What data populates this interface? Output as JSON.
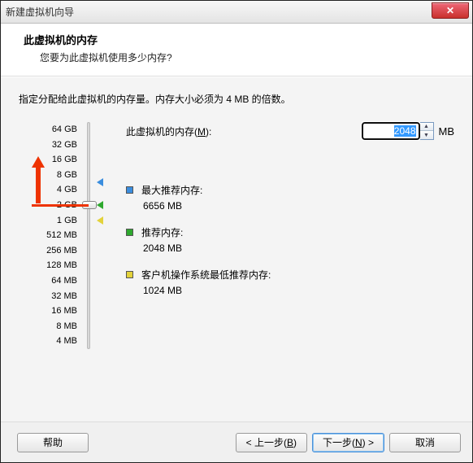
{
  "window": {
    "title": "新建虚拟机向导"
  },
  "header": {
    "title": "此虚拟机的内存",
    "subtitle": "您要为此虚拟机使用多少内存?"
  },
  "content": {
    "description": "指定分配给此虚拟机的内存量。内存大小必须为 4 MB 的倍数。",
    "memory_label_prefix": "此虚拟机的内存(",
    "memory_label_key": "M",
    "memory_label_suffix": "):",
    "memory_value": "2048",
    "memory_unit": "MB",
    "ticks": [
      "64 GB",
      "32 GB",
      "16 GB",
      "8 GB",
      "4 GB",
      "2 GB",
      "1 GB",
      "512 MB",
      "256 MB",
      "128 MB",
      "64 MB",
      "32 MB",
      "16 MB",
      "8 MB",
      "4 MB"
    ],
    "markers": {
      "max": {
        "label": "最大推荐内存:",
        "value": "6656 MB",
        "color": "#3a8dde",
        "tick_index": 3.5
      },
      "rec": {
        "label": "推荐内存:",
        "value": "2048 MB",
        "color": "#2ea82e",
        "tick_index": 5
      },
      "min": {
        "label": "客户机操作系统最低推荐内存:",
        "value": "1024 MB",
        "color": "#e3d23a",
        "tick_index": 6
      }
    }
  },
  "footer": {
    "help": "帮助",
    "back_prefix": "< 上一步(",
    "back_key": "B",
    "back_suffix": ")",
    "next_prefix": "下一步(",
    "next_key": "N",
    "next_suffix": ") >",
    "cancel": "取消"
  }
}
